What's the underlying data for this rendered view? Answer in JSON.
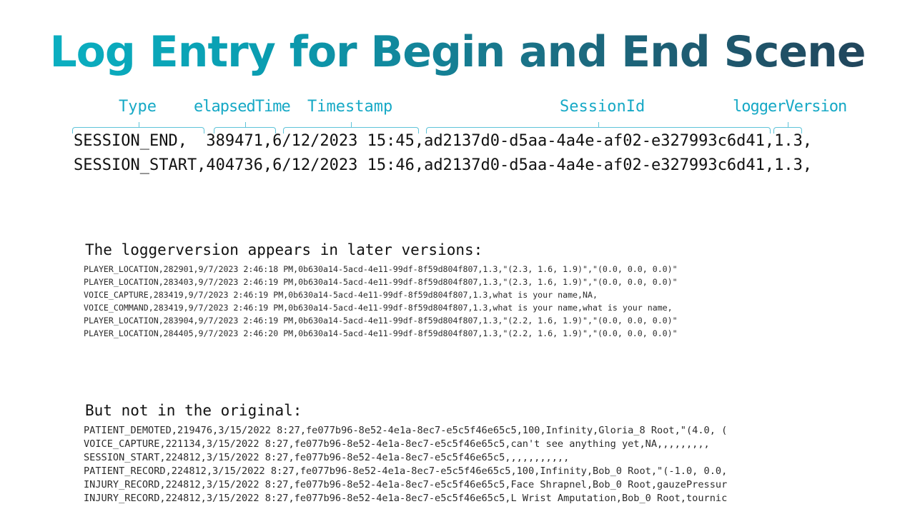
{
  "title": "Log Entry for Begin and End Scene",
  "annotations": {
    "type": "Type",
    "elapsed": "elapsedTime",
    "timestamp": "Timestamp",
    "session": "SessionId",
    "logger": "loggerVersion"
  },
  "log_lines": [
    "SESSION_END,  389471,6/12/2023 15:45,ad2137d0-d5aa-4a4e-af02-e327993c6d41,1.3,",
    "SESSION_START,404736,6/12/2023 15:46,ad2137d0-d5aa-4a4e-af02-e327993c6d41,1.3,"
  ],
  "note_later": "The loggerversion appears in later versions:",
  "later_rows": [
    "PLAYER_LOCATION,282901,9/7/2023 2:46:18 PM,0b630a14-5acd-4e11-99df-8f59d804f807,1.3,\"(2.3, 1.6, 1.9)\",\"(0.0, 0.0, 0.0)\"",
    "PLAYER_LOCATION,283403,9/7/2023 2:46:19 PM,0b630a14-5acd-4e11-99df-8f59d804f807,1.3,\"(2.3, 1.6, 1.9)\",\"(0.0, 0.0, 0.0)\"",
    "VOICE_CAPTURE,283419,9/7/2023 2:46:19 PM,0b630a14-5acd-4e11-99df-8f59d804f807,1.3,what is your name,NA,",
    "VOICE_COMMAND,283419,9/7/2023 2:46:19 PM,0b630a14-5acd-4e11-99df-8f59d804f807,1.3,what is your name,what is your name,",
    "PLAYER_LOCATION,283904,9/7/2023 2:46:19 PM,0b630a14-5acd-4e11-99df-8f59d804f807,1.3,\"(2.2, 1.6, 1.9)\",\"(0.0, 0.0, 0.0)\"",
    "PLAYER_LOCATION,284405,9/7/2023 2:46:20 PM,0b630a14-5acd-4e11-99df-8f59d804f807,1.3,\"(2.2, 1.6, 1.9)\",\"(0.0, 0.0, 0.0)\""
  ],
  "note_original": "But not in the original:",
  "original_rows": [
    "PATIENT_DEMOTED,219476,3/15/2022 8:27,fe077b96-8e52-4e1a-8ec7-e5c5f46e65c5,100,Infinity,Gloria_8 Root,\"(4.0, (",
    "VOICE_CAPTURE,221134,3/15/2022 8:27,fe077b96-8e52-4e1a-8ec7-e5c5f46e65c5,can't see anything yet,NA,,,,,,,,,",
    "SESSION_START,224812,3/15/2022 8:27,fe077b96-8e52-4e1a-8ec7-e5c5f46e65c5,,,,,,,,,,,",
    "PATIENT_RECORD,224812,3/15/2022 8:27,fe077b96-8e52-4e1a-8ec7-e5c5f46e65c5,100,Infinity,Bob_0 Root,\"(-1.0, 0.0,",
    "INJURY_RECORD,224812,3/15/2022 8:27,fe077b96-8e52-4e1a-8ec7-e5c5f46e65c5,Face Shrapnel,Bob_0 Root,gauzePressur",
    "INJURY_RECORD,224812,3/15/2022 8:27,fe077b96-8e52-4e1a-8ec7-e5c5f46e65c5,L Wrist Amputation,Bob_0 Root,tournic"
  ]
}
